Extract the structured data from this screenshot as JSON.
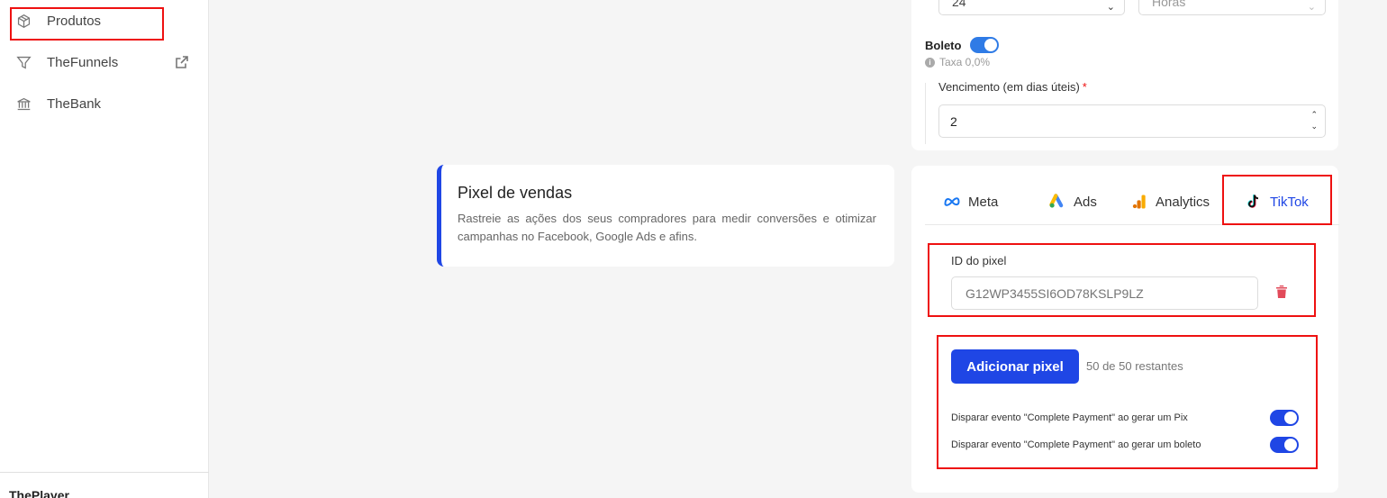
{
  "sidebar": {
    "items": [
      {
        "label": "Produtos",
        "icon": "box-icon"
      },
      {
        "label": "TheFunnels",
        "icon": "filter-icon"
      },
      {
        "label": "TheBank",
        "icon": "bank-icon"
      }
    ],
    "bottom_label": "ThePlayer"
  },
  "info_card": {
    "title": "Pixel de vendas",
    "description": "Rastreie as ações dos seus compradores para medir conversões e otimizar campanhas no Facebook, Google Ads e afins."
  },
  "top_card": {
    "select_left_value": "24",
    "select_right_value": "Horas",
    "boleto_label": "Boleto",
    "taxa_text": "Taxa 0,0%",
    "vencimento_label": "Vencimento (em dias úteis)",
    "required_mark": "*",
    "vencimento_value": "2"
  },
  "pixel_card": {
    "tabs": [
      {
        "label": "Meta",
        "icon": "meta-icon"
      },
      {
        "label": "Ads",
        "icon": "google-ads-icon"
      },
      {
        "label": "Analytics",
        "icon": "analytics-icon"
      },
      {
        "label": "TikTok",
        "icon": "tiktok-icon",
        "active": true
      }
    ],
    "id_label": "ID do pixel",
    "id_placeholder": "G12WP3455SI6OD78KSLP9LZ",
    "add_button": "Adicionar pixel",
    "remaining": "50 de 50 restantes",
    "events": [
      "Disparar evento \"Complete Payment\" ao gerar um Pix",
      "Disparar evento \"Complete Payment\" ao gerar um boleto"
    ]
  },
  "colors": {
    "accent": "#1f46e5",
    "toggle_blue": "#2f7be6",
    "highlight": "#ee1111",
    "trash": "#e24a5a"
  }
}
